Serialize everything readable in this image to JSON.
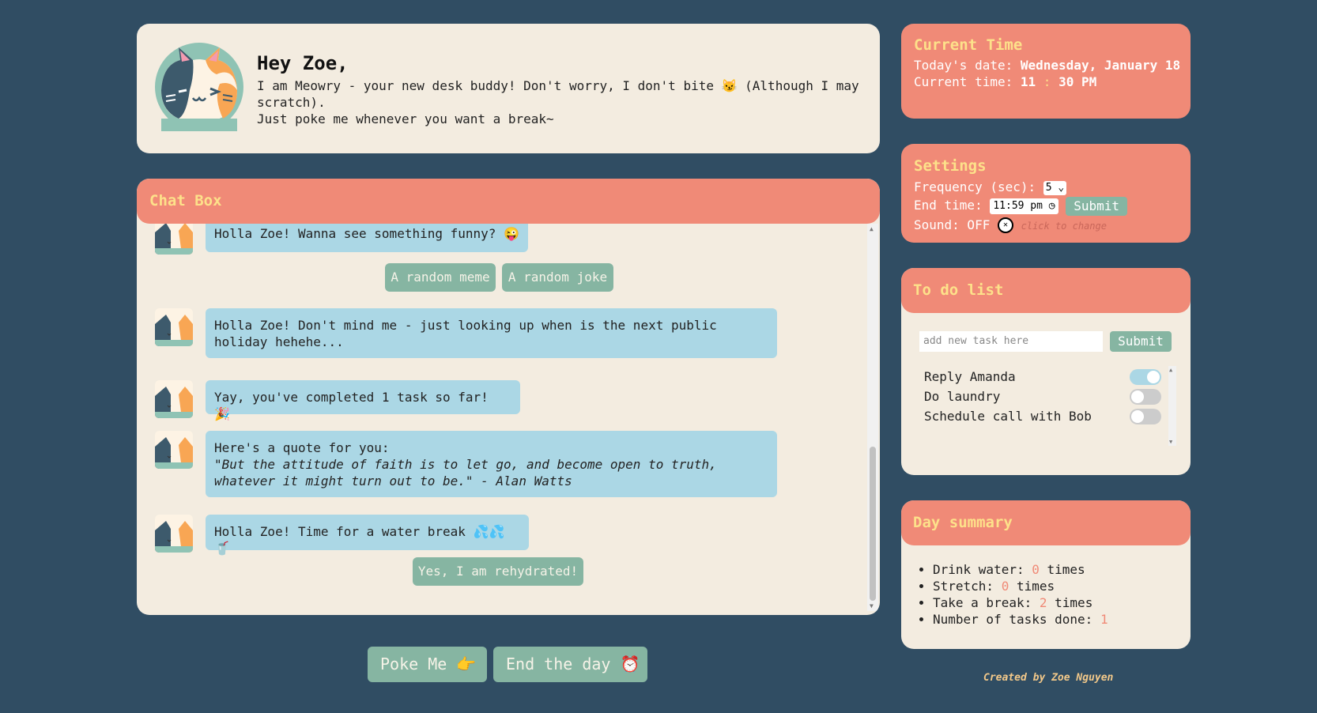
{
  "greeting": {
    "title": "Hey Zoe,",
    "line1": "I am Meowry - your new desk buddy! Don't worry, I don't bite 😼 (Although I may scratch).",
    "line2": "Just poke me whenever you want a break~"
  },
  "chat": {
    "header": "Chat Box",
    "messages": [
      {
        "text": "Holla Zoe! Wanna see something funny? 😜"
      },
      {
        "text": "Holla Zoe! Don't mind me - just looking up when is the next public holiday hehehe..."
      },
      {
        "text": "Yay, you've completed 1 task so far! 🎉"
      },
      {
        "quote_intro": "Here's a quote for you:",
        "quote": "\"But the attitude of faith is to let go, and become open to truth, whatever it might turn out to be.\" - Alan Watts"
      },
      {
        "text": "Holla Zoe! Time for a water break 💦💦🥤"
      }
    ],
    "buttons": {
      "meme": "A random meme",
      "joke": "A random joke",
      "rehydrated": "Yes, I am rehydrated!"
    }
  },
  "actions": {
    "poke": "Poke Me 👉",
    "end_day": "End the day ⏰"
  },
  "time": {
    "title": "Current Time",
    "date_label": "Today's date:",
    "date_value": "Wednesday, January 18",
    "time_label": "Current time:",
    "hour": "11",
    "sep": ":",
    "minute": "30 PM"
  },
  "settings": {
    "title": "Settings",
    "frequency_label": "Frequency (sec):",
    "frequency_value": "5",
    "end_time_label": "End time:",
    "end_time_value": "11:59 pm",
    "submit": "Submit",
    "sound_label": "Sound: OFF",
    "sound_hint": "click to change"
  },
  "todo": {
    "title": "To do list",
    "placeholder": "add new task here",
    "submit": "Submit",
    "tasks": [
      {
        "label": "Reply Amanda",
        "done": true
      },
      {
        "label": "Do laundry",
        "done": false
      },
      {
        "label": "Schedule call with Bob",
        "done": false
      }
    ]
  },
  "summary": {
    "title": "Day summary",
    "items": [
      {
        "label": "Drink water:",
        "count": "0",
        "unit": "times"
      },
      {
        "label": "Stretch:",
        "count": "0",
        "unit": "times"
      },
      {
        "label": "Take a break:",
        "count": "2",
        "unit": "times"
      },
      {
        "label": "Number of tasks done:",
        "count": "1",
        "unit": ""
      }
    ]
  },
  "credit": "Created by Zoe Nguyen",
  "colors": {
    "background": "#304d63",
    "card": "#f3ece0",
    "accent": "#f08a77",
    "header_text": "#fde18a",
    "bubble": "#abd7e5",
    "button": "#86b5a2"
  }
}
